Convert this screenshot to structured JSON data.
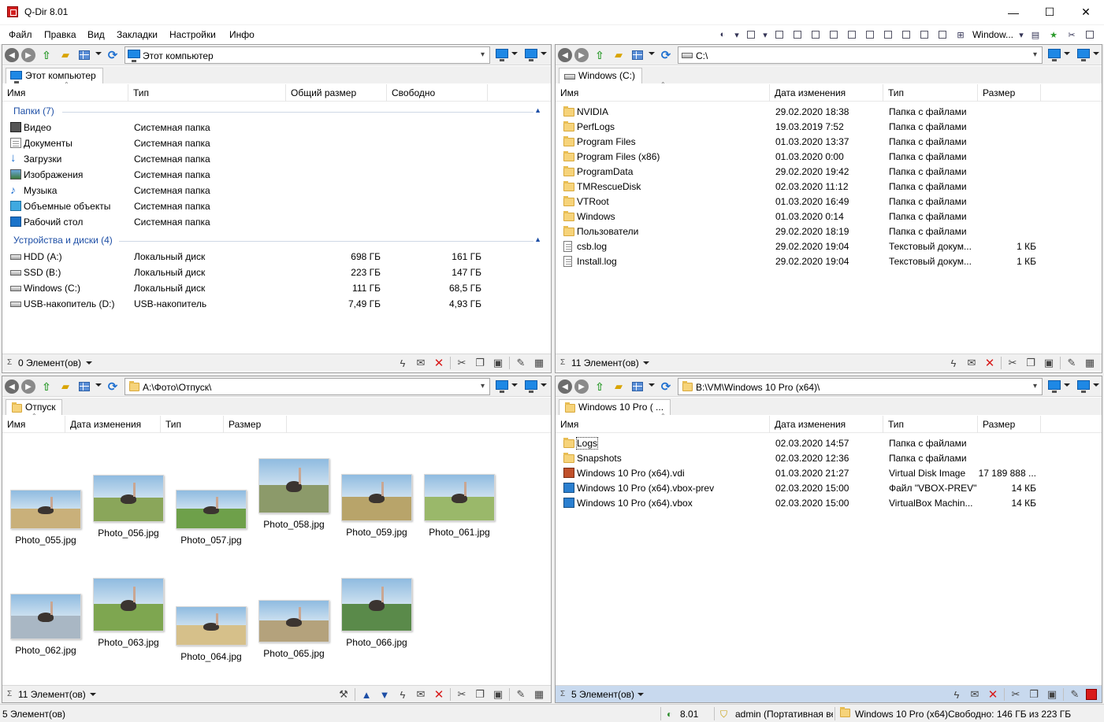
{
  "window": {
    "title": "Q-Dir 8.01",
    "minimize": "—",
    "maximize": "☐",
    "close": "✕"
  },
  "menu": [
    "Файл",
    "Правка",
    "Вид",
    "Закладки",
    "Настройки",
    "Инфо"
  ],
  "toolbar": {
    "layout_label": "Window..."
  },
  "panes": {
    "top_left": {
      "address": "Этот компьютер",
      "tab": "Этот компьютер",
      "columns": [
        "Имя",
        "Тип",
        "Общий размер",
        "Свободно"
      ],
      "groups": {
        "folders": {
          "title": "Папки (7)",
          "items": [
            {
              "name": "Видео",
              "type": "Системная папка",
              "icon": "video-folder-icon"
            },
            {
              "name": "Документы",
              "type": "Системная папка",
              "icon": "documents-folder-icon"
            },
            {
              "name": "Загрузки",
              "type": "Системная папка",
              "icon": "downloads-folder-icon"
            },
            {
              "name": "Изображения",
              "type": "Системная папка",
              "icon": "pictures-folder-icon"
            },
            {
              "name": "Музыка",
              "type": "Системная папка",
              "icon": "music-folder-icon"
            },
            {
              "name": "Объемные объекты",
              "type": "Системная папка",
              "icon": "3d-objects-folder-icon"
            },
            {
              "name": "Рабочий стол",
              "type": "Системная папка",
              "icon": "desktop-folder-icon"
            }
          ]
        },
        "drives": {
          "title": "Устройства и диски (4)",
          "items": [
            {
              "name": "HDD (A:)",
              "type": "Локальный диск",
              "total": "698 ГБ",
              "free": "161 ГБ"
            },
            {
              "name": "SSD (B:)",
              "type": "Локальный диск",
              "total": "223 ГБ",
              "free": "147 ГБ"
            },
            {
              "name": "Windows (C:)",
              "type": "Локальный диск",
              "total": "111 ГБ",
              "free": "68,5 ГБ"
            },
            {
              "name": "USB-накопитель (D:)",
              "type": "USB-накопитель",
              "total": "7,49 ГБ",
              "free": "4,93 ГБ"
            }
          ]
        }
      },
      "status": "0 Элемент(ов)"
    },
    "top_right": {
      "address": "C:\\",
      "tab": "Windows (C:)",
      "columns": [
        "Имя",
        "Дата изменения",
        "Тип",
        "Размер"
      ],
      "rows": [
        {
          "name": "NVIDIA",
          "date": "29.02.2020 18:38",
          "type": "Папка с файлами",
          "size": "",
          "icon": "folder-icon"
        },
        {
          "name": "PerfLogs",
          "date": "19.03.2019 7:52",
          "type": "Папка с файлами",
          "size": "",
          "icon": "folder-icon"
        },
        {
          "name": "Program Files",
          "date": "01.03.2020 13:37",
          "type": "Папка с файлами",
          "size": "",
          "icon": "folder-icon"
        },
        {
          "name": "Program Files (x86)",
          "date": "01.03.2020 0:00",
          "type": "Папка с файлами",
          "size": "",
          "icon": "folder-icon"
        },
        {
          "name": "ProgramData",
          "date": "29.02.2020 19:42",
          "type": "Папка с файлами",
          "size": "",
          "icon": "folder-icon"
        },
        {
          "name": "TMRescueDisk",
          "date": "02.03.2020 11:12",
          "type": "Папка с файлами",
          "size": "",
          "icon": "folder-icon"
        },
        {
          "name": "VTRoot",
          "date": "01.03.2020 16:49",
          "type": "Папка с файлами",
          "size": "",
          "icon": "folder-icon"
        },
        {
          "name": "Windows",
          "date": "01.03.2020 0:14",
          "type": "Папка с файлами",
          "size": "",
          "icon": "folder-icon"
        },
        {
          "name": "Пользователи",
          "date": "29.02.2020 18:19",
          "type": "Папка с файлами",
          "size": "",
          "icon": "folder-icon"
        },
        {
          "name": "csb.log",
          "date": "29.02.2020 19:04",
          "type": "Текстовый докум...",
          "size": "1 КБ",
          "icon": "text-file-icon"
        },
        {
          "name": "Install.log",
          "date": "29.02.2020 19:04",
          "type": "Текстовый докум...",
          "size": "1 КБ",
          "icon": "text-file-icon"
        }
      ],
      "status": "11 Элемент(ов)"
    },
    "bottom_left": {
      "address": "A:\\Фото\\Отпуск\\",
      "tab": "Отпуск",
      "columns": [
        "Имя",
        "Дата изменения",
        "Тип",
        "Размер"
      ],
      "photos": [
        "Photo_055.jpg",
        "Photo_056.jpg",
        "Photo_057.jpg",
        "Photo_058.jpg",
        "Photo_059.jpg",
        "Photo_061.jpg",
        "Photo_062.jpg",
        "Photo_063.jpg",
        "Photo_064.jpg",
        "Photo_065.jpg",
        "Photo_066.jpg"
      ],
      "status": "11 Элемент(ов)"
    },
    "bottom_right": {
      "address": "B:\\VM\\Windows 10 Pro (x64)\\",
      "tab": "Windows 10 Pro ( ...",
      "columns": [
        "Имя",
        "Дата изменения",
        "Тип",
        "Размер"
      ],
      "rows": [
        {
          "name": "Logs",
          "date": "02.03.2020 14:57",
          "type": "Папка с файлами",
          "size": "",
          "icon": "folder-icon"
        },
        {
          "name": "Snapshots",
          "date": "02.03.2020 12:36",
          "type": "Папка с файлами",
          "size": "",
          "icon": "folder-icon"
        },
        {
          "name": "Windows 10 Pro (x64).vdi",
          "date": "01.03.2020 21:27",
          "type": "Virtual Disk Image",
          "size": "17 189 888 ...",
          "icon": "virtual-disk-icon"
        },
        {
          "name": "Windows 10 Pro (x64).vbox-prev",
          "date": "02.03.2020 15:00",
          "type": "Файл \"VBOX-PREV\"",
          "size": "14 КБ",
          "icon": "vbox-file-icon"
        },
        {
          "name": "Windows 10 Pro (x64).vbox",
          "date": "02.03.2020 15:00",
          "type": "VirtualBox Machin...",
          "size": "14 КБ",
          "icon": "vbox-file-icon"
        }
      ],
      "status": "5 Элемент(ов)"
    }
  },
  "bottom_status": {
    "items": "5 Элемент(ов)",
    "version": "8.01",
    "user": "admin (Портативная ве",
    "folder": "Windows 10 Pro (x64)",
    "free": "Свободно: 146 ГБ из 223 ГБ"
  }
}
